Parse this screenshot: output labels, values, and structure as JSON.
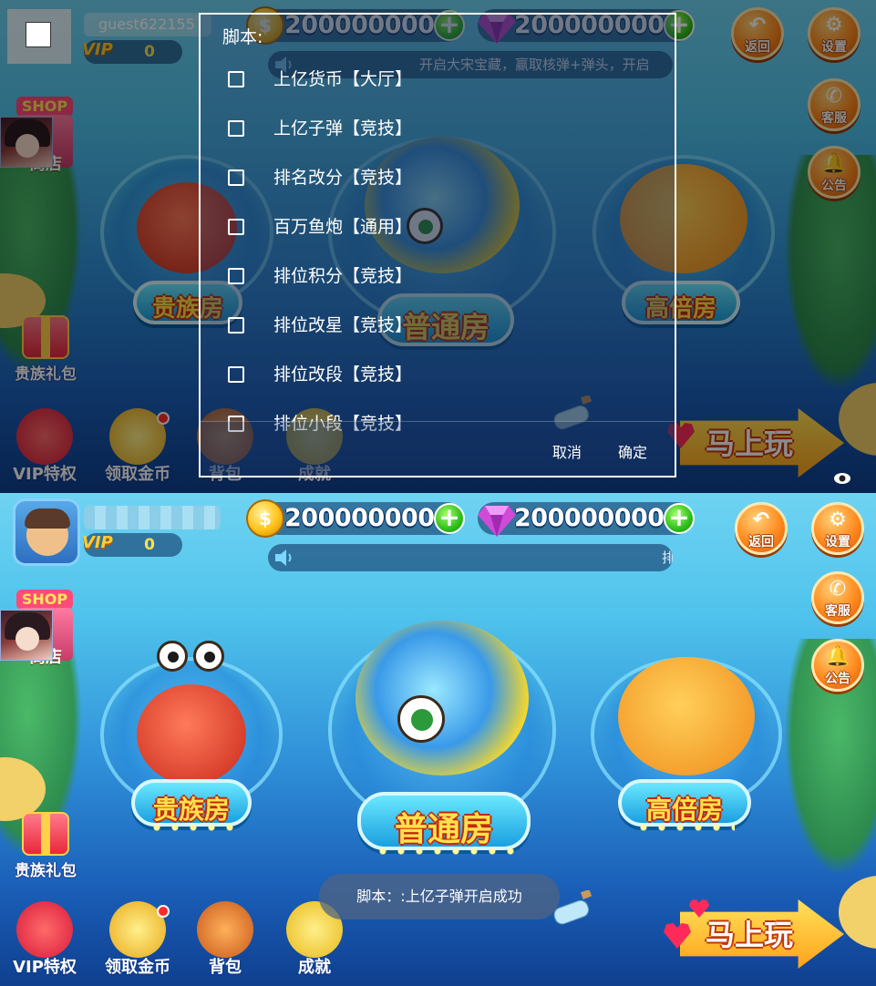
{
  "top_screen": {
    "username": "guest622155",
    "vip_label": "VIP",
    "vip_level": "0",
    "coins": "2000000000",
    "gems": "2000000000",
    "marquee_text": "开启大宋宝藏，赢取核弹+弹头，开启",
    "buttons": {
      "back": "返回",
      "settings": "设置",
      "service": "客服",
      "notice": "公告"
    },
    "shop_sign": "SHOP",
    "shop_label": "商店",
    "gift_label": "贵族礼包",
    "bottom_icons": [
      "VIP特权",
      "领取金币",
      "背包",
      "成就"
    ],
    "rooms": [
      "贵族房",
      "普通房",
      "高倍房"
    ],
    "play_label": "马上玩",
    "dialog": {
      "title": "脚本:",
      "options": [
        "上亿货币【大厅】",
        "上亿子弹【竞技】",
        "排名改分【竞技】",
        "百万鱼炮【通用】",
        "排位积分【竞技】",
        "排位改星【竞技】",
        "排位改段【竞技】",
        "排位小段【竞技】"
      ],
      "cancel": "取消",
      "confirm": "确定"
    }
  },
  "bottom_screen": {
    "vip_label": "VIP",
    "vip_level": "0",
    "coins": "2000000000",
    "gems": "2000000000",
    "marquee_text": "排",
    "buttons": {
      "back": "返回",
      "settings": "设置",
      "service": "客服",
      "notice": "公告"
    },
    "shop_sign": "SHOP",
    "shop_label": "商店",
    "gift_label": "贵族礼包",
    "bottom_icons": [
      "VIP特权",
      "领取金币",
      "背包",
      "成就"
    ],
    "rooms": [
      "贵族房",
      "普通房",
      "高倍房"
    ],
    "play_label": "马上玩",
    "toast": "脚本：:上亿子弹开启成功"
  },
  "colors": {
    "accent_orange": "#ff8a1e",
    "gold": "#ffe14d",
    "plus_green": "#2fbf1a"
  }
}
